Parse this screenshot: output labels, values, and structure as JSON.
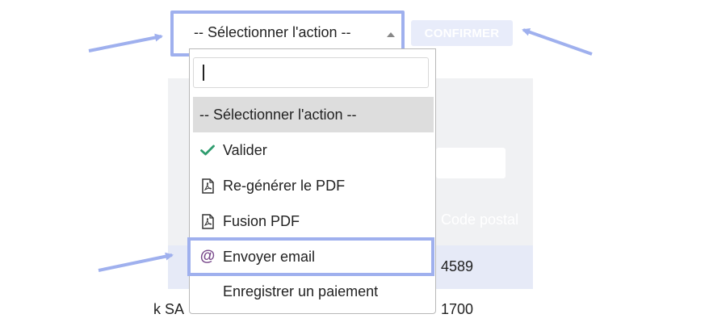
{
  "select": {
    "current_value": "-- Sélectionner l'action --"
  },
  "confirm_button": {
    "label": "CONFIRMER"
  },
  "dropdown": {
    "search": {
      "value": ""
    },
    "options": [
      {
        "label": "-- Sélectionner l'action --",
        "icon": "none",
        "selected": true
      },
      {
        "label": "Valider",
        "icon": "check-icon"
      },
      {
        "label": "Re-générer le PDF",
        "icon": "pdf-file-icon"
      },
      {
        "label": "Fusion PDF",
        "icon": "pdf-file-icon"
      },
      {
        "label": "Envoyer email",
        "icon": "at-sign-icon",
        "highlighted": true
      },
      {
        "label": "Enregistrer un paiement",
        "icon": "none"
      }
    ]
  },
  "background_table": {
    "column_header": "Code postal",
    "rows": [
      {
        "prefix": "",
        "code_postal": "4589"
      },
      {
        "prefix": "k SA",
        "code_postal": "1700"
      }
    ]
  },
  "colors": {
    "highlight_border": "#9fb0ee",
    "check": "#2e9c6e",
    "at_sign": "#7a4a8c",
    "confirm_bg": "#e8ecfa",
    "selected_option_bg": "#dddddd"
  }
}
